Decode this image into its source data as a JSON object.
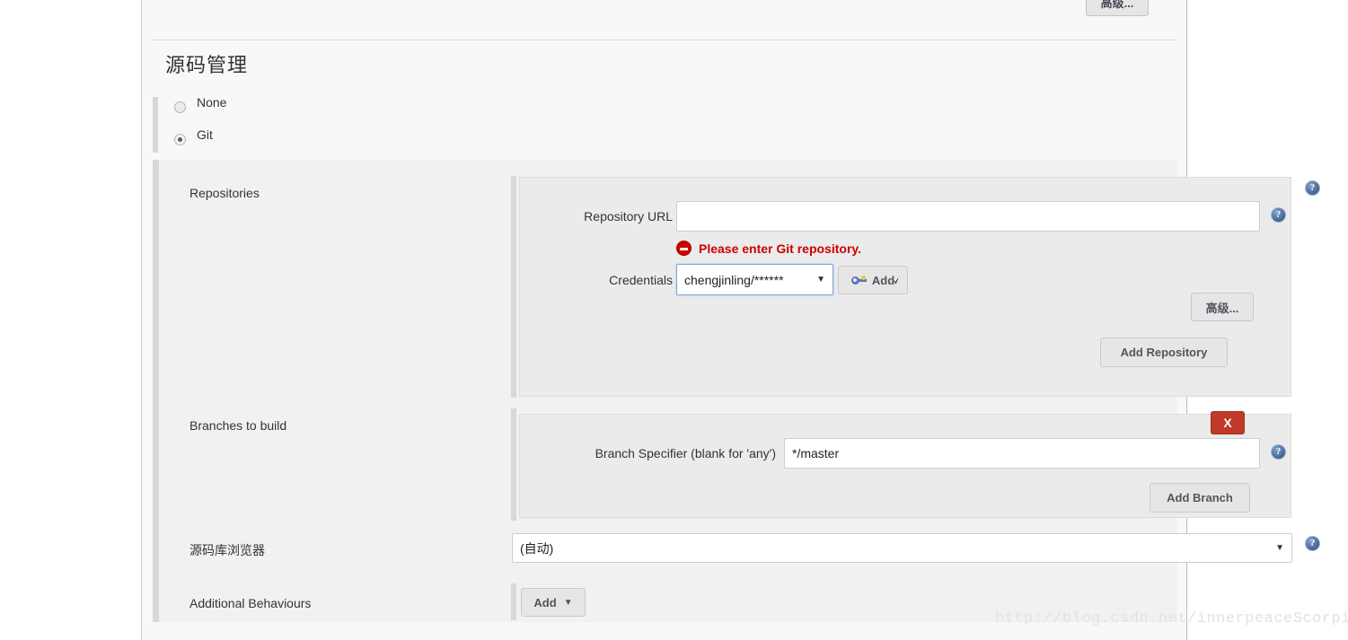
{
  "page": {
    "top_advanced_button": "高级...",
    "section_title": "源码管理",
    "watermark": "http://blog.csdn.net/innerpeaceScorpio"
  },
  "scm_options": [
    {
      "label": "None",
      "checked": false
    },
    {
      "label": "Git",
      "checked": true
    }
  ],
  "repositories": {
    "row_label": "Repositories",
    "url_label": "Repository URL",
    "url_value": "",
    "url_placeholder": "",
    "error_message": "Please enter Git repository.",
    "credentials_label": "Credentials",
    "credentials_value": "chengjinling/******",
    "add_credentials_label": "Add",
    "advanced_button": "高级...",
    "add_repository_button": "Add Repository",
    "help_icon": "help-icon"
  },
  "branches": {
    "row_label": "Branches to build",
    "specifier_label": "Branch Specifier (blank for 'any')",
    "specifier_value": "*/master",
    "delete_button": "X",
    "add_branch_button": "Add Branch"
  },
  "repo_browser": {
    "row_label": "源码库浏览器",
    "selected_value": "(自动)"
  },
  "additional_behaviours": {
    "row_label": "Additional Behaviours",
    "add_button": "Add"
  },
  "colors": {
    "error_red": "#cc0000",
    "delete_red": "#c0392b",
    "help_blue": "#42648f",
    "panel_grey": "#ebebeb",
    "block_grey": "#f1f1f1"
  }
}
